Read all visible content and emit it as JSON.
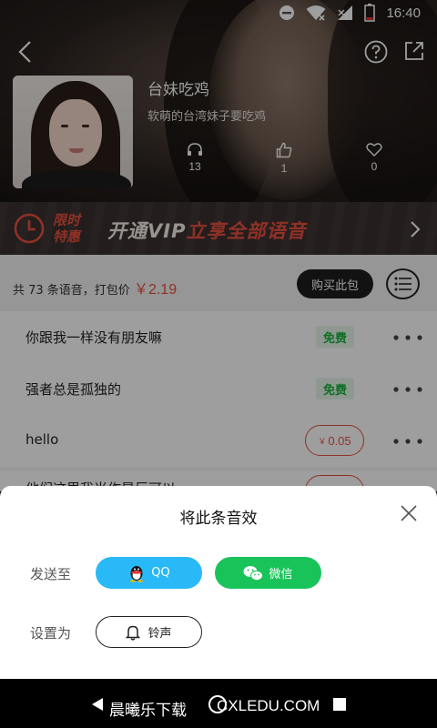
{
  "status_bar": {
    "time": "16:40"
  },
  "profile": {
    "name": "台妹吃鸡",
    "description": "软萌的台湾妹子要吃鸡",
    "stats": {
      "listens": "13",
      "likes": "1",
      "favorites": "0"
    }
  },
  "vip_banner": {
    "limit_line1": "限时",
    "limit_line2": "特惠",
    "text_white": "开通VIP",
    "text_red": "立享全部语音"
  },
  "summary": {
    "prefix": "共 73 条语音，打包价",
    "price": "￥2.19",
    "buy_label": "购买此包"
  },
  "clips": [
    {
      "title": "你跟我一样没有朋友嘛",
      "badge": "免费"
    },
    {
      "title": "强者总是孤独的",
      "badge": "免费"
    },
    {
      "title": "hello",
      "currency": "￥",
      "price": "0.05"
    },
    {
      "title": "他们这里我当作是巨可以"
    }
  ],
  "sheet": {
    "title": "将此条音效",
    "send_label": "发送至",
    "qq_label": "QQ",
    "wechat_label": "微信",
    "set_label": "设置为",
    "ringtone_label": "铃声"
  },
  "watermark": {
    "text_cn": "晨曦乐下载",
    "text_url": "CXLEDU.COM"
  },
  "colors": {
    "accent_red": "#e94f3e",
    "qq_blue": "#28b9f6",
    "wechat_green": "#18c45a",
    "free_green": "#16b23a"
  }
}
